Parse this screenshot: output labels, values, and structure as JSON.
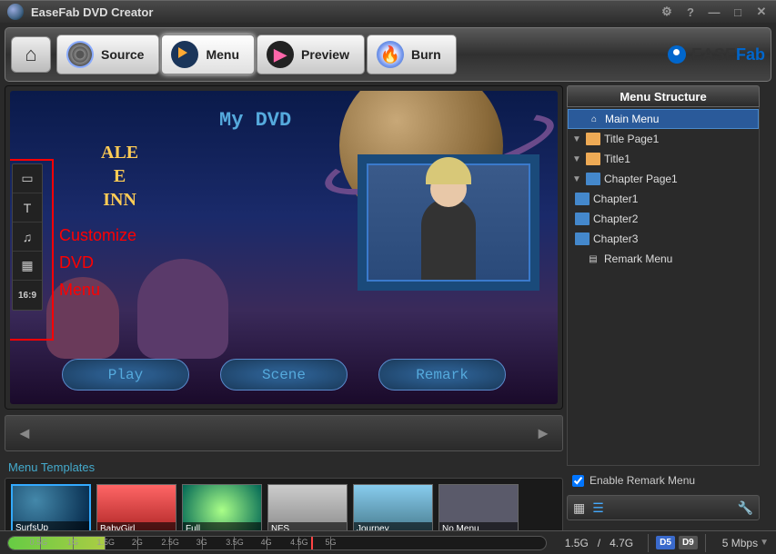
{
  "title": "EaseFab DVD Creator",
  "logo": {
    "brand1": "EASE",
    "brand2": "Fab"
  },
  "tabs": {
    "source": "Source",
    "menu": "Menu",
    "preview": "Preview",
    "burn": "Burn"
  },
  "side_tools": {
    "aspect": "16:9"
  },
  "annotation": {
    "line1": "Customize",
    "line2": "DVD",
    "line3": "Menu"
  },
  "dvd_title": "My DVD",
  "sign_text": "ALE\nE\nINN",
  "menu_buttons": {
    "play": "Play",
    "scene": "Scene",
    "remark": "Remark"
  },
  "templates_title": "Menu Templates",
  "templates": [
    "SurfsUp",
    "BabyGirl",
    "Full",
    "NFS",
    "Journey",
    "No Menu"
  ],
  "right_title": "Menu Structure",
  "tree": {
    "main": "Main Menu",
    "titlepage": "Title Page1",
    "title": "Title1",
    "chapterpage": "Chapter Page1",
    "ch1": "Chapter1",
    "ch2": "Chapter2",
    "ch3": "Chapter3",
    "remark": "Remark Menu"
  },
  "enable_remark": "Enable Remark Menu",
  "status": {
    "used": "1.5G",
    "total": "4.7G",
    "d5": "D5",
    "d9": "D9",
    "rate": "5 Mbps",
    "ticks": [
      "0.5G",
      "1G",
      "1.5G",
      "2G",
      "2.5G",
      "3G",
      "3.5G",
      "4G",
      "4.5G",
      "5G"
    ]
  }
}
